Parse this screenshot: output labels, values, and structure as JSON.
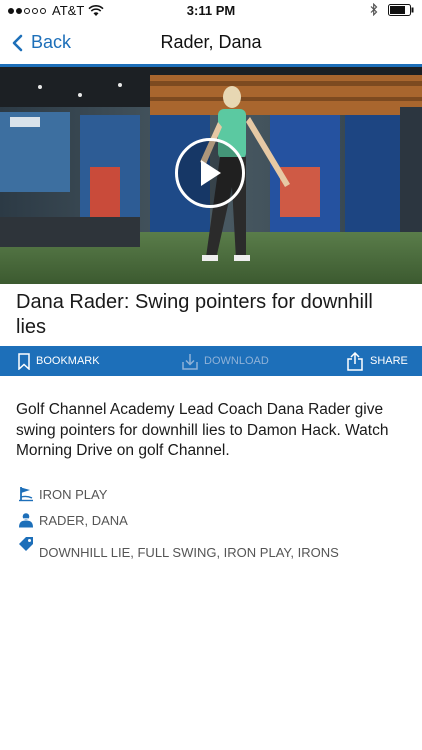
{
  "status": {
    "carrier": "AT&T",
    "time": "3:11 PM"
  },
  "nav": {
    "back_label": "Back",
    "title": "Rader, Dana"
  },
  "video": {
    "title": "Dana Rader: Swing pointers for downhill lies"
  },
  "actions": {
    "bookmark": "BOOKMARK",
    "download": "DOWNLOAD",
    "share": "SHARE"
  },
  "description": "Golf Channel Academy Lead Coach Dana Rader give swing pointers for downhill lies to Damon Hack. Watch Morning Drive on golf Channel.",
  "meta": {
    "category": "IRON PLAY",
    "instructor": "RADER, DANA",
    "tags": "DOWNHILL LIE, FULL SWING, IRON PLAY, IRONS"
  },
  "colors": {
    "accent": "#1d6fb9"
  }
}
